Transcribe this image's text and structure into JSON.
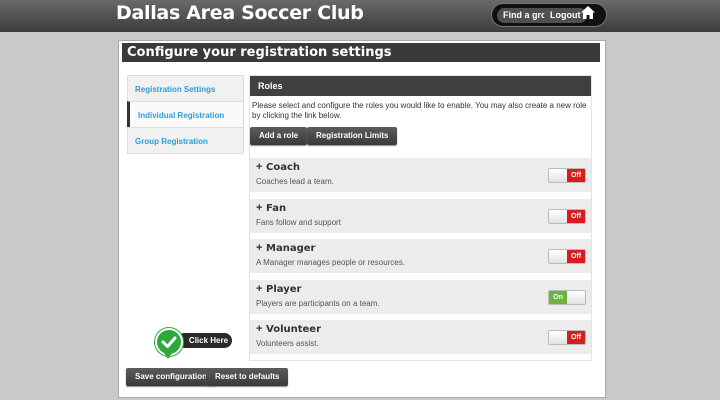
{
  "header": {
    "club_name": "Dallas Area Soccer Club",
    "find_group_label": "Find a group",
    "logout_label": "Logout",
    "home_icon": "home-icon"
  },
  "panel": {
    "title": "Configure your registration settings"
  },
  "sidebar": {
    "items": [
      {
        "label": "Registration Settings",
        "active": false
      },
      {
        "label": "Individual Registration",
        "active": true
      },
      {
        "label": "Group Registration",
        "active": false
      }
    ]
  },
  "roles": {
    "header": "Roles",
    "description": "Please select and configure the roles you would like to enable. You may also create a new role by clicking the link below.",
    "add_role_label": "Add a role",
    "registration_limits_label": "Registration Limits",
    "items": [
      {
        "name": "Coach",
        "description": "Coaches lead a team.",
        "state": "Off"
      },
      {
        "name": "Fan",
        "description": "Fans follow and support",
        "state": "Off"
      },
      {
        "name": "Manager",
        "description": "A Manager manages people or resources.",
        "state": "Off"
      },
      {
        "name": "Player",
        "description": "Players are participants on a team.",
        "state": "On"
      },
      {
        "name": "Volunteer",
        "description": "Volunteers assist.",
        "state": "Off"
      }
    ],
    "expand_symbol": "+"
  },
  "callout": {
    "label": "Click Here"
  },
  "footer": {
    "save_label": "Save configuration",
    "reset_label": "Reset to defaults"
  },
  "colors": {
    "accent_link": "#2a9fd6",
    "toggle_off": "#d71e1e",
    "toggle_on": "#6db33f",
    "callout_green": "#2ea83a"
  }
}
